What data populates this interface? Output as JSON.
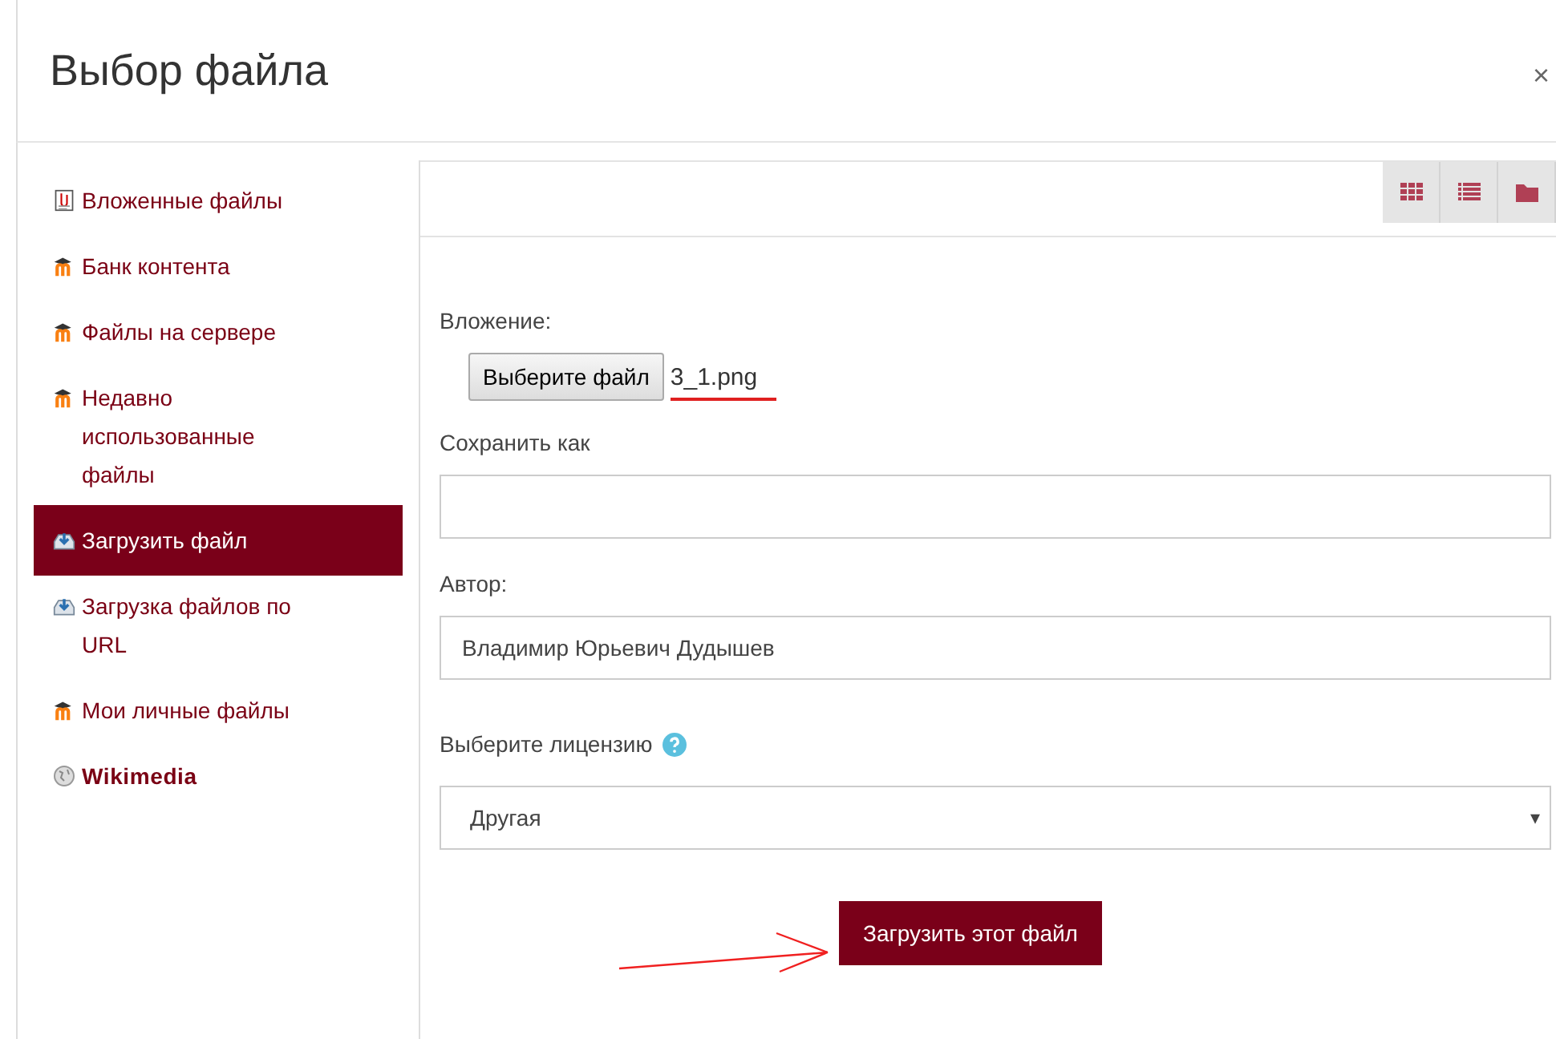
{
  "dialog": {
    "title": "Выбор файла",
    "close": "×"
  },
  "sidebar": {
    "items": [
      {
        "label": "Вложенные файлы",
        "kind": "attachment",
        "selected": false
      },
      {
        "label": "Банк контента",
        "kind": "moodle",
        "selected": false
      },
      {
        "label": "Файлы на сервере",
        "kind": "moodle",
        "selected": false
      },
      {
        "label": "Недавно использованные файлы",
        "kind": "moodle",
        "selected": false
      },
      {
        "label": "Загрузить файл",
        "kind": "upload",
        "selected": true
      },
      {
        "label": "Загрузка файлов по URL",
        "kind": "upload",
        "selected": false
      },
      {
        "label": "Мои личные файлы",
        "kind": "moodle",
        "selected": false
      },
      {
        "label": "Wikimedia",
        "kind": "globe",
        "selected": false
      }
    ]
  },
  "toolbar": {
    "buttons": [
      {
        "kind": "grid"
      },
      {
        "kind": "list"
      },
      {
        "kind": "folder"
      }
    ]
  },
  "form": {
    "attachment_label": "Вложение:",
    "choose_button": "Выберите файл",
    "file_name": "3_1.png",
    "save_as_label": "Сохранить как",
    "author_label": "Автор:",
    "author_value": "Владимир Юрьевич Дудышев",
    "license_label": "Выберите лицензию",
    "license_value": "Другая",
    "license_caret": "▾",
    "submit": "Загрузить этот файл"
  }
}
